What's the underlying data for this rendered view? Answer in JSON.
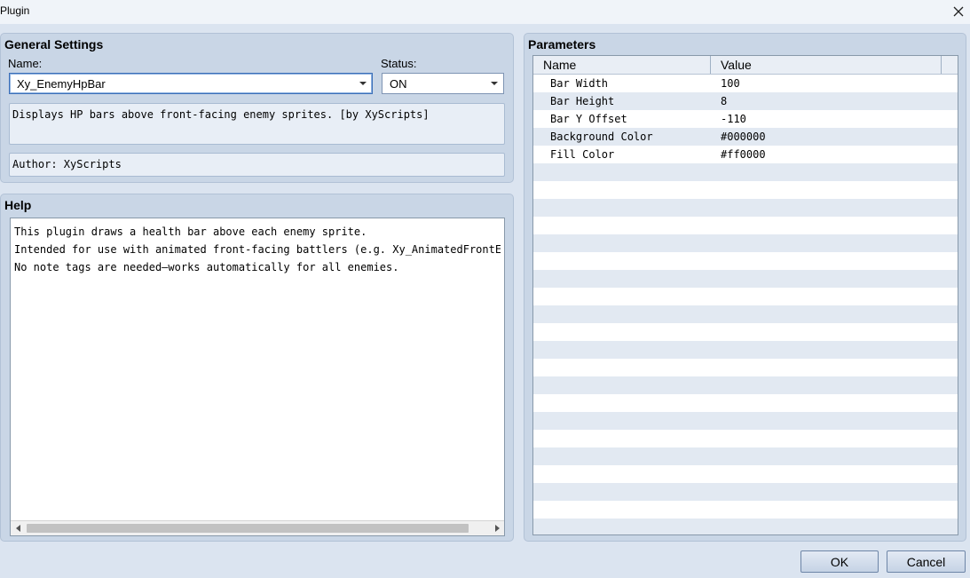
{
  "window": {
    "title": "Plugin"
  },
  "general_settings": {
    "title": "General Settings",
    "name_label": "Name:",
    "name_value": "Xy_EnemyHpBar",
    "status_label": "Status:",
    "status_value": "ON",
    "description": "Displays HP bars above front-facing enemy sprites. [by XyScripts]",
    "author": "Author: XyScripts"
  },
  "help": {
    "title": "Help",
    "lines": [
      "This plugin draws a health bar above each enemy sprite.",
      "Intended for use with animated front-facing battlers (e.g. Xy_AnimatedFrontEnemy)",
      "No note tags are needed—works automatically for all enemies."
    ]
  },
  "parameters": {
    "title": "Parameters",
    "columns": [
      "Name",
      "Value"
    ],
    "rows": [
      {
        "name": "Bar Width",
        "value": "100"
      },
      {
        "name": "Bar Height",
        "value": "8"
      },
      {
        "name": "Bar Y Offset",
        "value": "-110"
      },
      {
        "name": "Background Color",
        "value": "#000000"
      },
      {
        "name": "Fill Color",
        "value": "#ff0000"
      }
    ]
  },
  "buttons": {
    "ok": "OK",
    "cancel": "Cancel"
  }
}
